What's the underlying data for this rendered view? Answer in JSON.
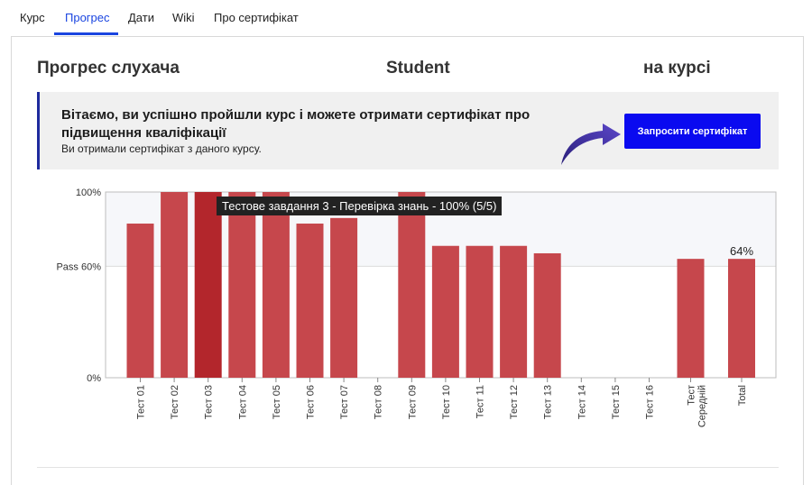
{
  "tabs": [
    {
      "label": "Курс",
      "active": false
    },
    {
      "label": "Прогрес",
      "active": true
    },
    {
      "label": "Дати",
      "active": false
    },
    {
      "label": "Wiki",
      "active": false
    },
    {
      "label": "Про сертифікат",
      "active": false
    }
  ],
  "header": {
    "left": "Прогрес слухача",
    "middle": "Student",
    "right": "на курсі"
  },
  "banner": {
    "title": "Вітаємо, ви успішно пройшли курс і можете отримати сертифікат про підвищення кваліфікації",
    "subtitle": "Ви отримали сертифікат з даного курсу.",
    "button_label": "Запросити сертифікат",
    "arrow_icon": "curved-arrow-icon"
  },
  "tooltip": "Тестове завдання 3 - Перевірка знань - 100% (5/5)",
  "colors": {
    "accent": "#1a45e0",
    "button": "#0a0af0",
    "bar": "#c6474c",
    "bar_highlight": "#b3262c"
  },
  "chart_data": {
    "type": "bar",
    "categories": [
      "Тест 01",
      "Тест 02",
      "Тест 03",
      "Тест 04",
      "Тест 05",
      "Тест 06",
      "Тест 07",
      "Тест 08",
      "Тест 09",
      "Тест 10",
      "Тест 11",
      "Тест 12",
      "Тест 13",
      "Тест 14",
      "Тест 15",
      "Тест 16",
      "Тест Середній",
      "Total"
    ],
    "values": [
      83,
      100,
      100,
      100,
      100,
      83,
      86,
      0,
      100,
      71,
      71,
      71,
      67,
      0,
      0,
      0,
      64,
      64
    ],
    "highlighted_index": 2,
    "y_ticks": [
      {
        "value": 100,
        "label": "100%"
      },
      {
        "value": 60,
        "label": "Pass 60%"
      },
      {
        "value": 0,
        "label": "0%"
      }
    ],
    "pass_threshold": 60,
    "ylim": [
      0,
      100
    ],
    "data_labels": [
      {
        "index": 17,
        "label": "64%"
      }
    ],
    "grid": true
  }
}
